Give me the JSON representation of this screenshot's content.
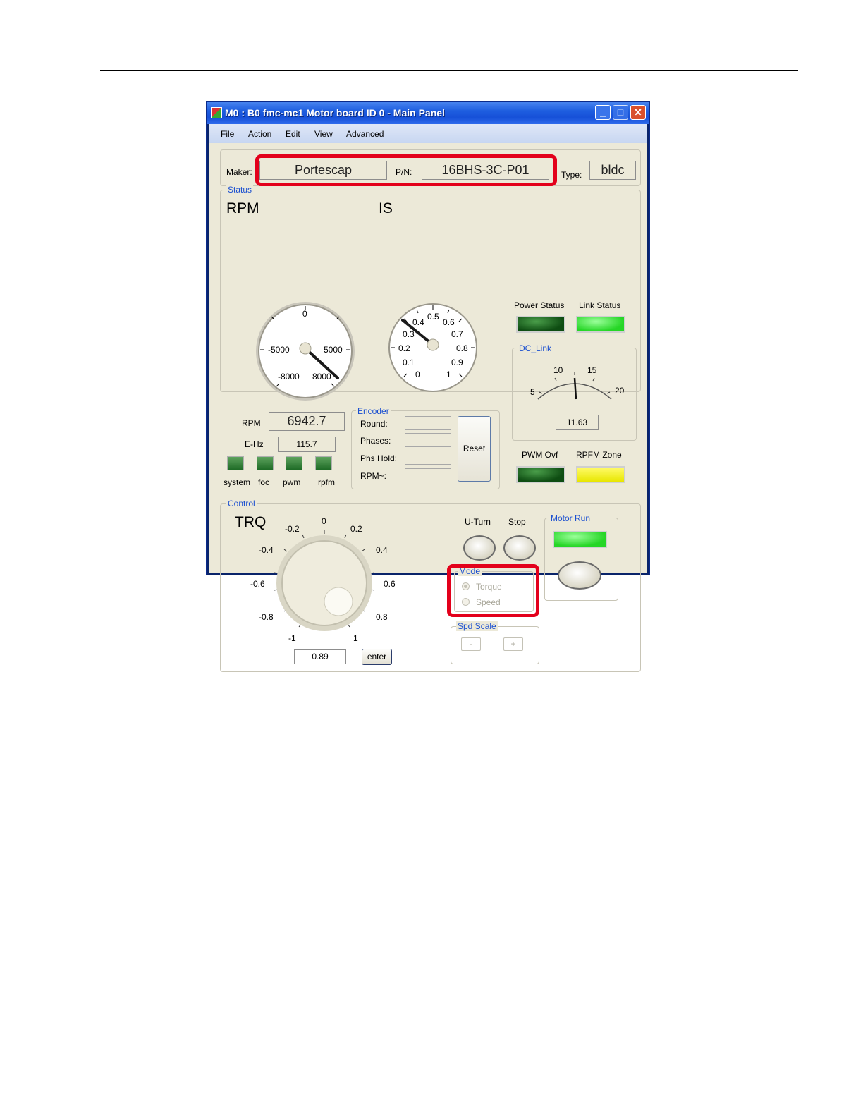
{
  "window": {
    "title": "M0 : B0 fmc-mc1  Motor board ID 0 -  Main Panel",
    "minimize": "_",
    "maximize": "□",
    "close": "✕"
  },
  "menu": [
    "File",
    "Action",
    "Edit",
    "View",
    "Advanced"
  ],
  "header": {
    "maker_label": "Maker:",
    "maker_value": "Portescap",
    "pn_label": "P/N:",
    "pn_value": "16BHS-3C-P01",
    "type_label": "Type:",
    "type_value": "bldc"
  },
  "status": {
    "group_label": "Status",
    "rpm_gauge": {
      "title": "RPM",
      "labels": [
        "0",
        "-5000",
        "5000",
        "-8000",
        "8000"
      ],
      "value": 6942.7
    },
    "is_gauge": {
      "title": "IS",
      "labels": [
        "0.5",
        "0.4",
        "0.6",
        "0.3",
        "0.7",
        "0.2",
        "0.8",
        "0.1",
        "0.9",
        "0",
        "1"
      ]
    },
    "power_status_label": "Power Status",
    "link_status_label": "Link Status",
    "dc_link": {
      "group_label": "DC_Link",
      "labels": [
        "10",
        "15",
        "5",
        "20"
      ],
      "value": "11.63"
    },
    "rpm_label": "RPM",
    "rpm_value": "6942.7",
    "ehz_label": "E-Hz",
    "ehz_value": "115.7",
    "leds": [
      "system",
      "foc",
      "pwm",
      "rpfm"
    ],
    "pwm_ovf_label": "PWM Ovf",
    "rpfm_zone_label": "RPFM Zone",
    "encoder": {
      "group_label": "Encoder",
      "fields": [
        "Round:",
        "Phases:",
        "Phs Hold:",
        "RPM~:"
      ],
      "reset_label": "Reset"
    },
    "colors": {
      "led_dark": "#0e4d12",
      "led_green": "#26d626",
      "led_yellow": "#e8e600"
    }
  },
  "control": {
    "group_label": "Control",
    "trq_title": "TRQ",
    "trq_scale": [
      "0",
      "-0.2",
      "0.2",
      "-0.4",
      "0.4",
      "-0.6",
      "0.6",
      "-0.8",
      "0.8",
      "-1",
      "1"
    ],
    "trq_value": "0.89",
    "enter_label": "enter",
    "uturn_label": "U-Turn",
    "stop_label": "Stop",
    "mode": {
      "group_label": "Mode",
      "options": [
        "Torque",
        "Speed"
      ],
      "selected": "Torque"
    },
    "spd_scale": {
      "group_label": "Spd Scale",
      "minus": "-",
      "plus": "+"
    },
    "motor_run": {
      "group_label": "Motor Run"
    }
  }
}
